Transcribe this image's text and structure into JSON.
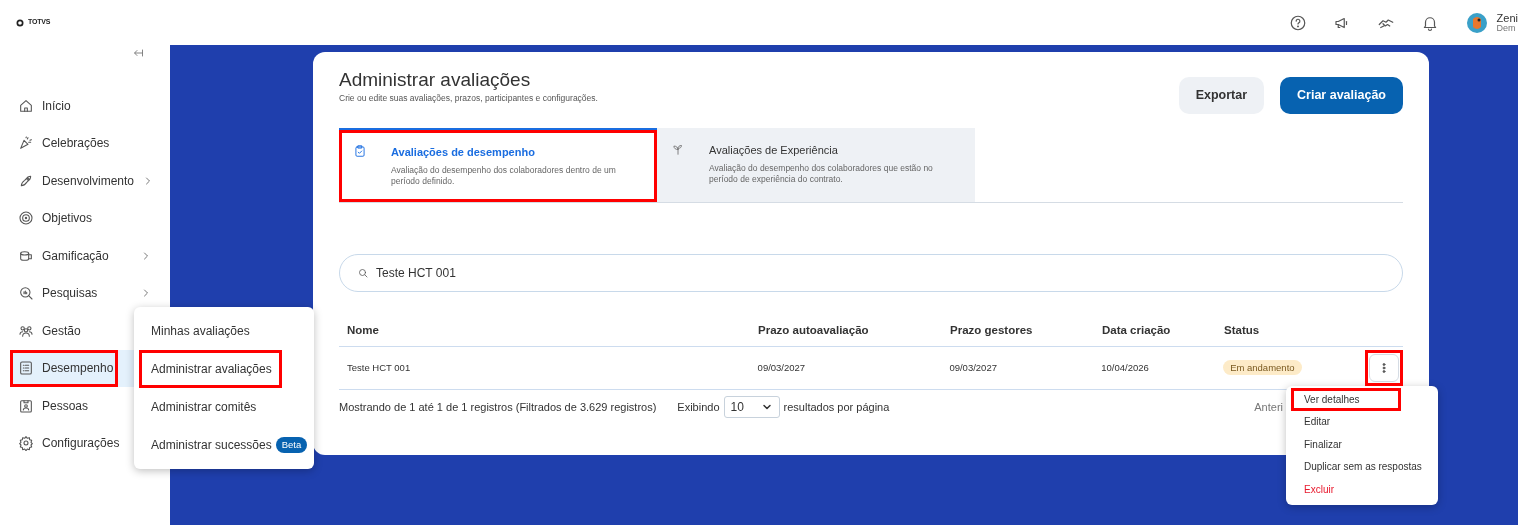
{
  "header": {
    "logo": "TOTVS",
    "user": {
      "name": "Zeni",
      "subtitle": "Dem"
    }
  },
  "sidebar": {
    "items": [
      {
        "label": "Início",
        "selected": false,
        "expandable": false,
        "highlighted": false
      },
      {
        "label": "Celebrações",
        "selected": false,
        "expandable": false,
        "highlighted": false
      },
      {
        "label": "Desenvolvimento",
        "selected": false,
        "expandable": true,
        "highlighted": false
      },
      {
        "label": "Objetivos",
        "selected": false,
        "expandable": false,
        "highlighted": false
      },
      {
        "label": "Gamificação",
        "selected": false,
        "expandable": true,
        "highlighted": false
      },
      {
        "label": "Pesquisas",
        "selected": false,
        "expandable": true,
        "highlighted": false
      },
      {
        "label": "Gestão",
        "selected": false,
        "expandable": false,
        "highlighted": false
      },
      {
        "label": "Desempenho",
        "selected": true,
        "expandable": false,
        "highlighted": true
      },
      {
        "label": "Pessoas",
        "selected": false,
        "expandable": false,
        "highlighted": false
      },
      {
        "label": "Configurações",
        "selected": false,
        "expandable": false,
        "highlighted": false
      }
    ]
  },
  "submenu": {
    "items": [
      {
        "label": "Minhas avaliações",
        "highlighted": false
      },
      {
        "label": "Administrar avaliações",
        "highlighted": true
      },
      {
        "label": "Administrar comitês",
        "highlighted": false
      },
      {
        "label": "Administrar sucessões",
        "highlighted": false,
        "badge": "Beta"
      }
    ]
  },
  "page": {
    "title": "Administrar avaliações",
    "subtitle": "Crie ou edite suas avaliações, prazos, participantes e configurações.",
    "buttons": [
      {
        "label": "Exportar",
        "kind": "secondary"
      },
      {
        "label": "Criar avaliação",
        "kind": "primary"
      }
    ]
  },
  "tabs": [
    {
      "title": "Avaliações de desempenho",
      "description": "Avaliação do desempenho dos colaboradores dentro de um período definido.",
      "selected": true,
      "highlighted": true
    },
    {
      "title": "Avaliações de Experiência",
      "description": "Avaliação do desempenho dos colaboradores que estão no período de experiência do contrato.",
      "selected": false,
      "highlighted": false
    }
  ],
  "search": {
    "value": "Teste HCT 001"
  },
  "table": {
    "columns": [
      "Nome",
      "Prazo autoavaliação",
      "Prazo gestores",
      "Data criação",
      "Status"
    ],
    "rows": [
      {
        "cells": [
          "Teste HCT 001",
          "09/03/2027",
          "09/03/2027",
          "10/04/2026"
        ],
        "status": "Em andamento",
        "menu_highlighted": true
      }
    ]
  },
  "footer": {
    "summary": "Mostrando de 1 até 1 de 1 registros (Filtrados de 3.629 registros)",
    "per_page_prefix": "Exibindo",
    "per_page": "10",
    "per_page_suffix": "resultados por página",
    "previous": "Anteri"
  },
  "row_menu": {
    "items": [
      {
        "label": "Ver detalhes",
        "kind": "normal",
        "highlighted": true
      },
      {
        "label": "Editar",
        "kind": "normal",
        "highlighted": false
      },
      {
        "label": "Finalizar",
        "kind": "normal",
        "highlighted": false
      },
      {
        "label": "Duplicar sem as respostas",
        "kind": "normal",
        "highlighted": false
      },
      {
        "label": "Excluir",
        "kind": "danger",
        "highlighted": false
      }
    ]
  }
}
